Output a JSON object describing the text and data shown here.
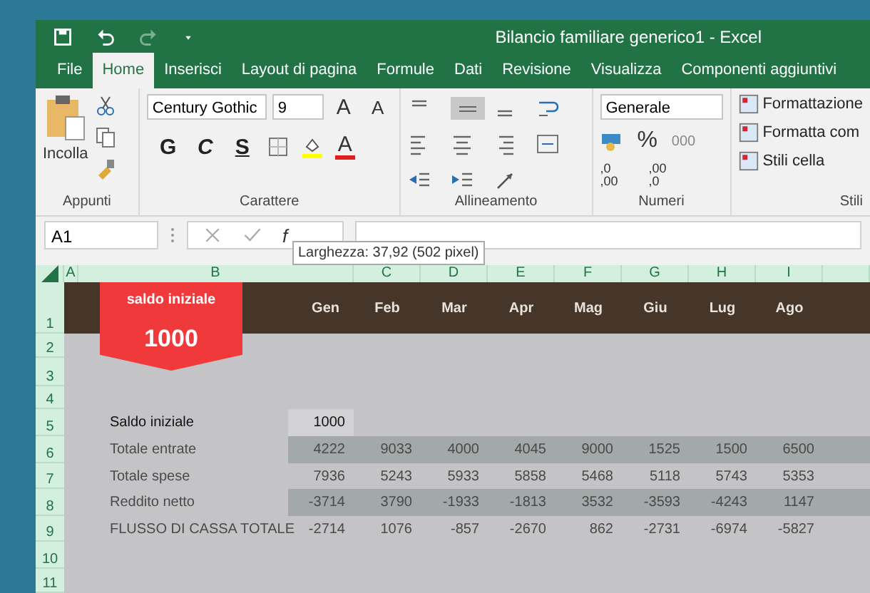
{
  "title_bar": {
    "title": "Bilancio familiare generico1 - Excel"
  },
  "tabs": [
    {
      "label": "File",
      "selected": false
    },
    {
      "label": "Home",
      "selected": true
    },
    {
      "label": "Inserisci",
      "selected": false
    },
    {
      "label": "Layout di pagina",
      "selected": false
    },
    {
      "label": "Formule",
      "selected": false
    },
    {
      "label": "Dati",
      "selected": false
    },
    {
      "label": "Revisione",
      "selected": false
    },
    {
      "label": "Visualizza",
      "selected": false
    },
    {
      "label": "Componenti aggiuntivi",
      "selected": false
    }
  ],
  "ribbon": {
    "clipboard": {
      "paste": "Incolla",
      "group": "Appunti"
    },
    "font": {
      "name": "Century Gothic",
      "size": "9",
      "grow": "A",
      "shrink": "A",
      "bold": "G",
      "italic": "C",
      "underline": "S",
      "font_color": "A",
      "group": "Carattere"
    },
    "alignment": {
      "group": "Allineamento"
    },
    "number": {
      "format": "Generale",
      "percent": "%",
      "thousands": "000",
      "decimals": [
        ",0 ,00",
        ",00 ,0"
      ],
      "group": "Numeri"
    },
    "styles": {
      "items": [
        "Formattazione",
        "Formatta com",
        "Stili cella"
      ],
      "group": "Stili"
    }
  },
  "formula_bar": {
    "name_box": "A1",
    "fx": "f",
    "tooltip": "Larghezza: 37,92 (502 pixel)"
  },
  "sheet": {
    "columns": [
      "A",
      "B",
      "C",
      "D",
      "E",
      "F",
      "G",
      "H",
      "I"
    ],
    "row_numbers": [
      "1",
      "2",
      "3",
      "4",
      "5",
      "6",
      "7",
      "8",
      "9",
      "10",
      "11"
    ],
    "months": [
      "Gen",
      "Feb",
      "Mar",
      "Apr",
      "Mag",
      "Giu",
      "Lug",
      "Ago"
    ],
    "badge": {
      "label": "saldo iniziale",
      "value": "1000"
    },
    "rows": [
      {
        "label": "Saldo iniziale",
        "shaded": false,
        "highlighted": true,
        "values": [
          "1000"
        ]
      },
      {
        "label": "Totale entrate",
        "shaded": true,
        "highlighted": false,
        "values": [
          "4222",
          "9033",
          "4000",
          "4045",
          "9000",
          "1525",
          "1500",
          "6500"
        ]
      },
      {
        "label": "Totale spese",
        "shaded": false,
        "highlighted": false,
        "values": [
          "7936",
          "5243",
          "5933",
          "5858",
          "5468",
          "5118",
          "5743",
          "5353"
        ]
      },
      {
        "label": "Reddito netto",
        "shaded": true,
        "highlighted": false,
        "values": [
          "-3714",
          "3790",
          "-1933",
          "-1813",
          "3532",
          "-3593",
          "-4243",
          "1147"
        ]
      },
      {
        "label": "FLUSSO DI CASSA TOTALE",
        "shaded": false,
        "highlighted": false,
        "values": [
          "-2714",
          "1076",
          "-857",
          "-2670",
          "862",
          "-2731",
          "-6974",
          "-5827"
        ]
      }
    ]
  }
}
